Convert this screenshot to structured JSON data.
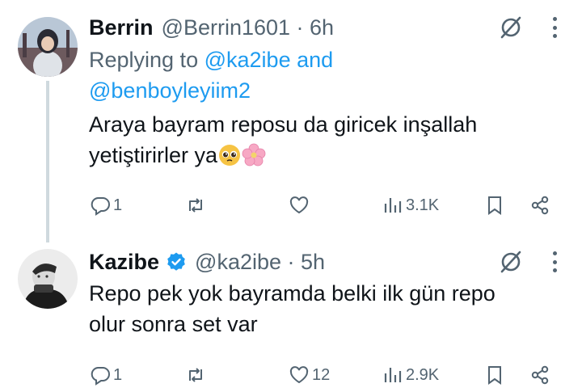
{
  "tweets": [
    {
      "display_name": "Berrin",
      "meta": "@Berrin1601 · 6h",
      "replying_prefix": "Replying to",
      "replying_handle_1": "@ka2ibe",
      "replying_and": "and",
      "replying_handle_2": "@benboyleyiim2",
      "text_line_1": "Araya bayram reposu da giricek inşallah",
      "text_line_2": "yetiştirirler ya",
      "emojis": [
        "pleading-face",
        "cherry-blossom"
      ],
      "reply_count": "1",
      "retweet_count": "",
      "like_count": "",
      "view_count": "3.1K"
    },
    {
      "display_name": "Kazibe",
      "verified": true,
      "meta": "@ka2ibe · 5h",
      "text_line_1": "Repo pek yok bayramda belki ilk gün repo",
      "text_line_2": "olur sonra set var",
      "reply_count": "1",
      "retweet_count": "",
      "like_count": "12",
      "view_count": "2.9K"
    }
  ],
  "colors": {
    "text": "#0f1419",
    "secondary": "#536471",
    "link": "#1d9bf0",
    "thread_line": "#cfd9de"
  },
  "icons": [
    "grok-icon",
    "more-icon",
    "reply-icon",
    "retweet-icon",
    "like-icon",
    "views-icon",
    "bookmark-icon",
    "share-icon",
    "verified-badge-icon"
  ]
}
